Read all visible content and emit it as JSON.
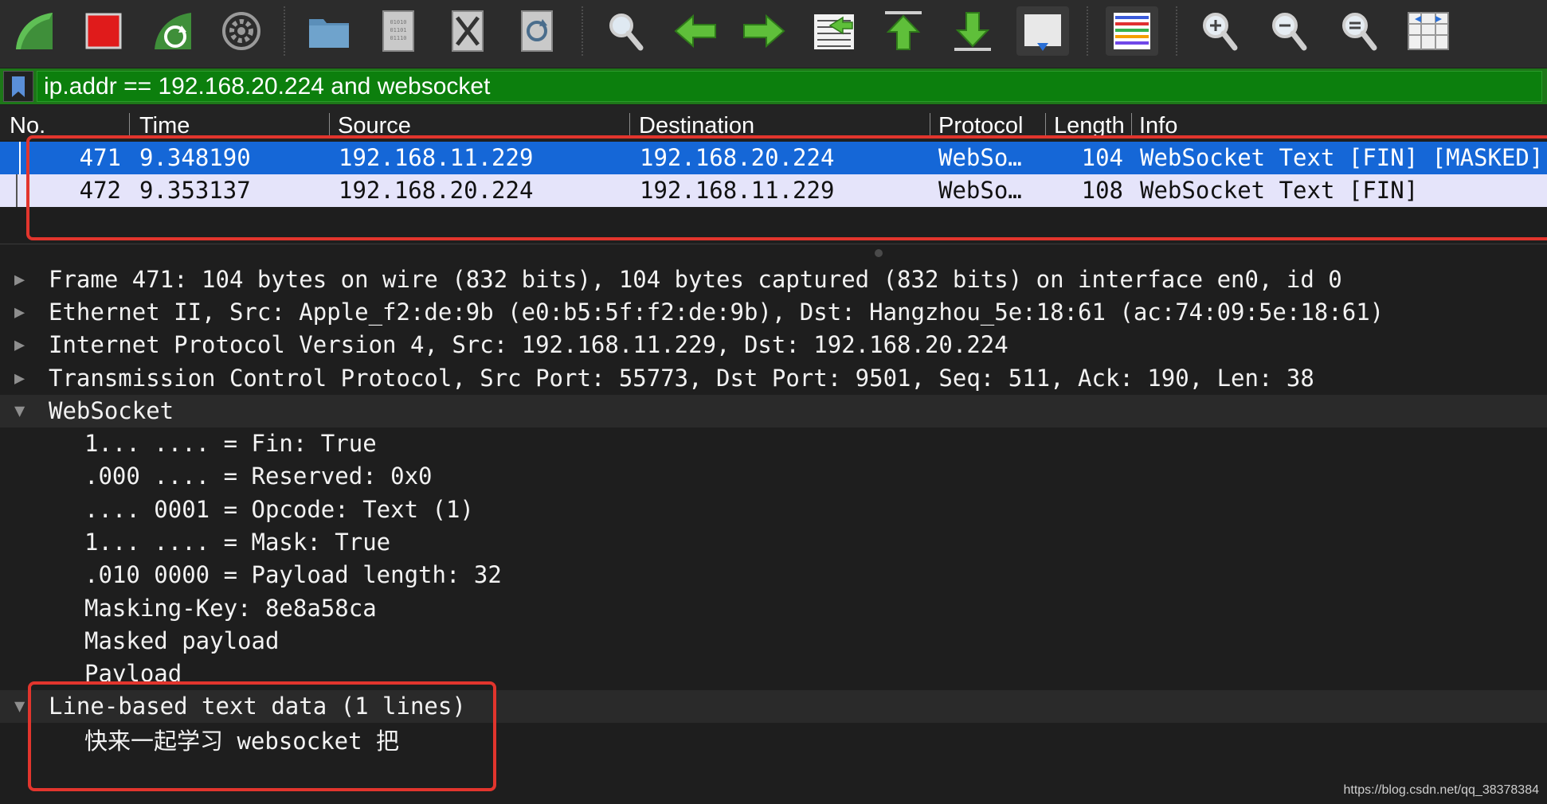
{
  "toolbar": {
    "buttons": [
      {
        "name": "start-capture-icon"
      },
      {
        "name": "stop-capture-icon"
      },
      {
        "name": "restart-capture-icon"
      },
      {
        "name": "capture-options-icon"
      },
      {
        "name": "open-file-icon"
      },
      {
        "name": "save-file-icon"
      },
      {
        "name": "close-file-icon"
      },
      {
        "name": "reload-file-icon"
      },
      {
        "name": "find-packet-icon"
      },
      {
        "name": "go-back-icon"
      },
      {
        "name": "go-forward-icon"
      },
      {
        "name": "go-to-packet-icon"
      },
      {
        "name": "go-first-packet-icon"
      },
      {
        "name": "go-last-packet-icon"
      },
      {
        "name": "auto-scroll-icon"
      },
      {
        "name": "colorize-icon"
      },
      {
        "name": "zoom-in-icon"
      },
      {
        "name": "zoom-out-icon"
      },
      {
        "name": "normal-size-icon"
      },
      {
        "name": "resize-columns-icon"
      }
    ]
  },
  "filter": {
    "value": "ip.addr == 192.168.20.224 and websocket",
    "bg_color": "#1d7718"
  },
  "packet_list": {
    "columns": [
      "No.",
      "Time",
      "Source",
      "Destination",
      "Protocol",
      "Length",
      "Info"
    ],
    "rows": [
      {
        "no": "471",
        "time": "9.348190",
        "source": "192.168.11.229",
        "destination": "192.168.20.224",
        "protocol": "WebSo…",
        "length": "104",
        "info": "WebSocket Text [FIN] [MASKED]",
        "selected": true
      },
      {
        "no": "472",
        "time": "9.353137",
        "source": "192.168.20.224",
        "destination": "192.168.11.229",
        "protocol": "WebSo…",
        "length": "108",
        "info": "WebSocket Text [FIN]",
        "selected": false
      }
    ],
    "selected_color": "#1567d7",
    "row_color": "#e5e4fa"
  },
  "details": {
    "frame": "Frame 471: 104 bytes on wire (832 bits), 104 bytes captured (832 bits) on interface en0, id 0",
    "ethernet": "Ethernet II, Src: Apple_f2:de:9b (e0:b5:5f:f2:de:9b), Dst: Hangzhou_5e:18:61 (ac:74:09:5e:18:61)",
    "ip": "Internet Protocol Version 4, Src: 192.168.11.229, Dst: 192.168.20.224",
    "tcp": "Transmission Control Protocol, Src Port: 55773, Dst Port: 9501, Seq: 511, Ack: 190, Len: 38",
    "websocket": "WebSocket",
    "websocket_fields": [
      "1... .... = Fin: True",
      ".000 .... = Reserved: 0x0",
      ".... 0001 = Opcode: Text (1)",
      "1... .... = Mask: True",
      ".010 0000 = Payload length: 32",
      "Masking-Key: 8e8a58ca",
      "Masked payload",
      "Payload"
    ],
    "line_based": "Line-based text data (1 lines)",
    "payload_text": "快来一起学习 websocket 把"
  },
  "annotation_color": "#e2352d",
  "watermark": "https://blog.csdn.net/qq_38378384"
}
